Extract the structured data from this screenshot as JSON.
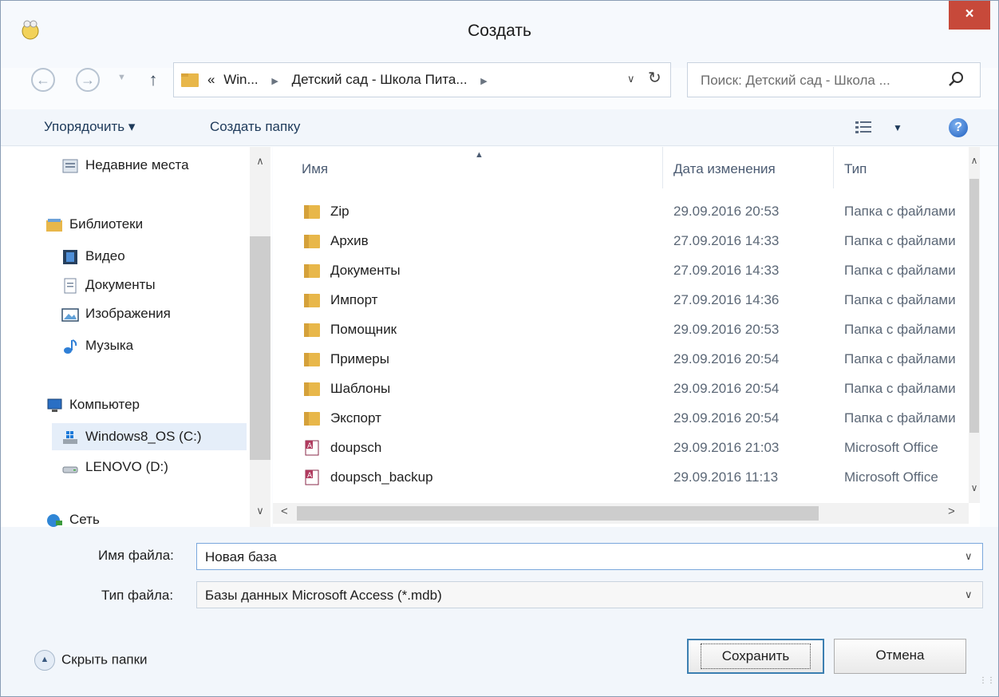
{
  "window": {
    "title": "Создать",
    "close_label": "×"
  },
  "address": {
    "crumbs": [
      "«",
      "Win...",
      "Детский сад - Школа Пита..."
    ],
    "search_placeholder": "Поиск: Детский сад - Школа ..."
  },
  "toolbar": {
    "organize": "Упорядочить ▾",
    "new_folder": "Создать папку",
    "help": "?"
  },
  "navpane": {
    "recent": "Недавние места",
    "libraries": "Библиотеки",
    "video": "Видео",
    "documents": "Документы",
    "images": "Изображения",
    "music": "Музыка",
    "computer": "Компьютер",
    "drive_c": "Windows8_OS (C:)",
    "drive_d": "LENOVO (D:)",
    "network": "Сеть"
  },
  "columns": {
    "name": "Имя",
    "date": "Дата изменения",
    "type": "Тип"
  },
  "files": [
    {
      "name": "Zip",
      "date": "29.09.2016 20:53",
      "type": "Папка с файлами",
      "kind": "folder"
    },
    {
      "name": "Архив",
      "date": "27.09.2016 14:33",
      "type": "Папка с файлами",
      "kind": "folder"
    },
    {
      "name": "Документы",
      "date": "27.09.2016 14:33",
      "type": "Папка с файлами",
      "kind": "folder"
    },
    {
      "name": "Импорт",
      "date": "27.09.2016 14:36",
      "type": "Папка с файлами",
      "kind": "folder"
    },
    {
      "name": "Помощник",
      "date": "29.09.2016 20:53",
      "type": "Папка с файлами",
      "kind": "folder"
    },
    {
      "name": "Примеры",
      "date": "29.09.2016 20:54",
      "type": "Папка с файлами",
      "kind": "folder"
    },
    {
      "name": "Шаблоны",
      "date": "29.09.2016 20:54",
      "type": "Папка с файлами",
      "kind": "folder"
    },
    {
      "name": "Экспорт",
      "date": "29.09.2016 20:54",
      "type": "Папка с файлами",
      "kind": "folder"
    },
    {
      "name": "doupsch",
      "date": "29.09.2016 21:03",
      "type": "Microsoft Office",
      "kind": "access"
    },
    {
      "name": "doupsch_backup",
      "date": "29.09.2016 11:13",
      "type": "Microsoft Office",
      "kind": "access"
    }
  ],
  "form": {
    "filename_label": "Имя файла:",
    "filename_value": "Новая база",
    "filetype_label": "Тип файла:",
    "filetype_value": "Базы данных Microsoft Access (*.mdb)"
  },
  "footer": {
    "hide_folders": "Скрыть папки",
    "save": "Сохранить",
    "cancel": "Отмена"
  },
  "colors": {
    "close": "#c7493a",
    "folder": "#e8b74a",
    "selection": "#e5eef9",
    "accent": "#3c7fb1"
  }
}
